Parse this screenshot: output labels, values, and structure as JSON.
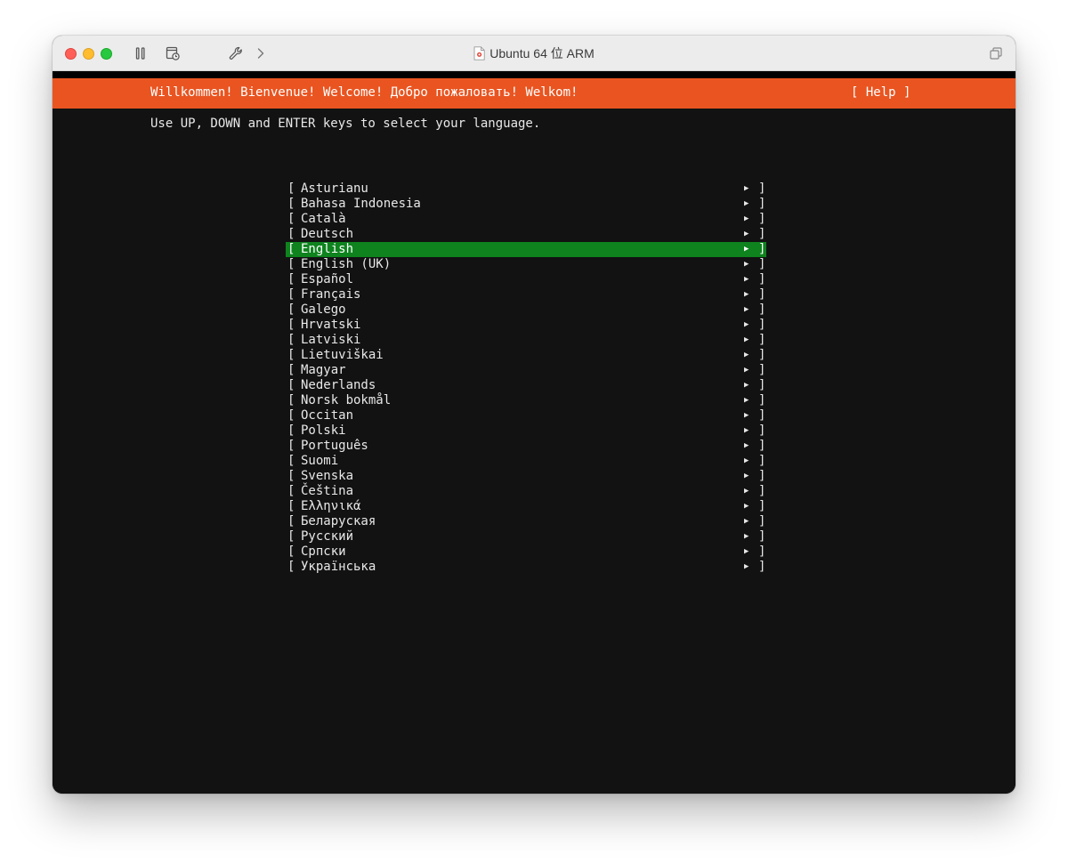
{
  "window": {
    "title": "Ubuntu 64 位 ARM",
    "toolbar_icons": [
      "pause-icon",
      "snapshot-icon",
      "wrench-icon",
      "chevron-right-icon",
      "window-copy-icon"
    ]
  },
  "installer": {
    "header_welcome": "Willkommen! Bienvenue! Welcome! Добро пожаловать! Welkom!",
    "help_label": "[ Help ]",
    "instruction": "Use UP, DOWN and ENTER keys to select your language.",
    "bracket_left": "[",
    "bracket_right": "]",
    "arrow": "▶",
    "languages": [
      "Asturianu",
      "Bahasa Indonesia",
      "Català",
      "Deutsch",
      "English",
      "English (UK)",
      "Español",
      "Français",
      "Galego",
      "Hrvatski",
      "Latviski",
      "Lietuviškai",
      "Magyar",
      "Nederlands",
      "Norsk bokmål",
      "Occitan",
      "Polski",
      "Português",
      "Suomi",
      "Svenska",
      "Čeština",
      "Ελληνικά",
      "Беларуская",
      "Русский",
      "Српски",
      "Українська"
    ],
    "selected_language": "English"
  },
  "colors": {
    "header_orange": "#e95420",
    "selection_green": "#0e831e",
    "terminal_bg": "#121212"
  }
}
